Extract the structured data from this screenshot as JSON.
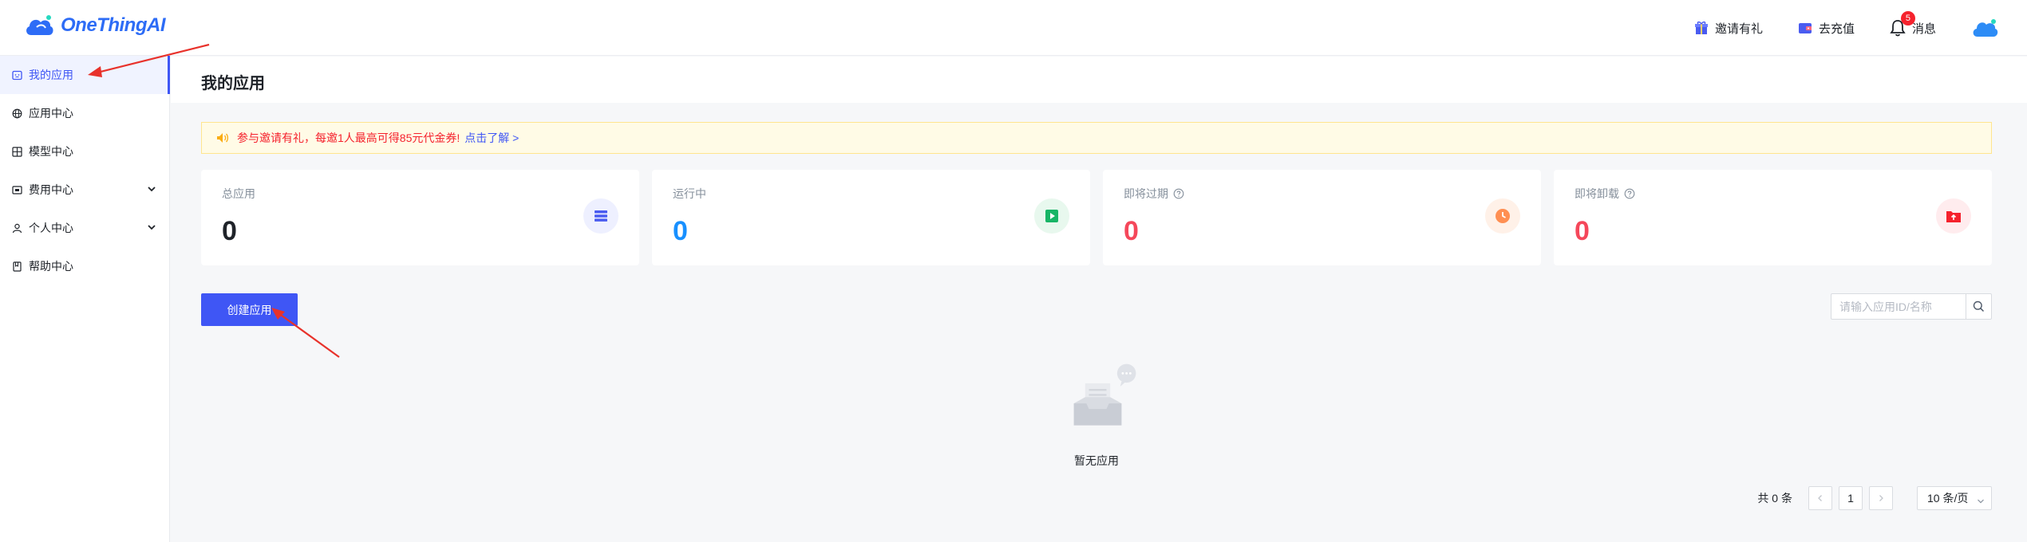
{
  "app": {
    "logo_text": "OneThingAI"
  },
  "header": {
    "invite_label": "邀请有礼",
    "recharge_label": "去充值",
    "messages_label": "消息",
    "messages_badge": "5"
  },
  "sidebar": {
    "items": [
      {
        "label": "我的应用",
        "icon": "app-window-icon",
        "active": true
      },
      {
        "label": "应用中心",
        "icon": "globe-icon"
      },
      {
        "label": "模型中心",
        "icon": "model-grid-icon"
      },
      {
        "label": "费用中心",
        "icon": "wallet-icon",
        "expandable": true
      },
      {
        "label": "个人中心",
        "icon": "user-icon",
        "expandable": true
      },
      {
        "label": "帮助中心",
        "icon": "book-icon"
      }
    ]
  },
  "main": {
    "page_title": "我的应用",
    "notice": {
      "text": "参与邀请有礼，每邀1人最高可得85元代金券!",
      "link": "点击了解 >"
    },
    "stats": [
      {
        "label": "总应用",
        "value": "0",
        "color": "#1f2329",
        "icon_bg": "#eef0ff",
        "icon_color": "#4a5cf0"
      },
      {
        "label": "运行中",
        "value": "0",
        "color": "#1890ff",
        "icon_bg": "#e8f8ee",
        "icon_color": "#18b566"
      },
      {
        "label": "即将过期",
        "value": "0",
        "color": "#f5475a",
        "icon_bg": "#fff1e8",
        "icon_color": "#ff8f52"
      },
      {
        "label": "即将卸载",
        "value": "0",
        "color": "#f5475a",
        "icon_bg": "#ffecee",
        "icon_color": "#f5222d"
      }
    ],
    "create_button": "创建应用",
    "search_placeholder": "请输入应用ID/名称",
    "empty_text": "暂无应用",
    "pagination": {
      "total": "共 0 条",
      "current_page": "1",
      "page_size": "10 条/页"
    }
  },
  "colors": {
    "primary": "#3f56f5",
    "danger": "#f5222d",
    "annotation_arrow": "#e8322b"
  }
}
